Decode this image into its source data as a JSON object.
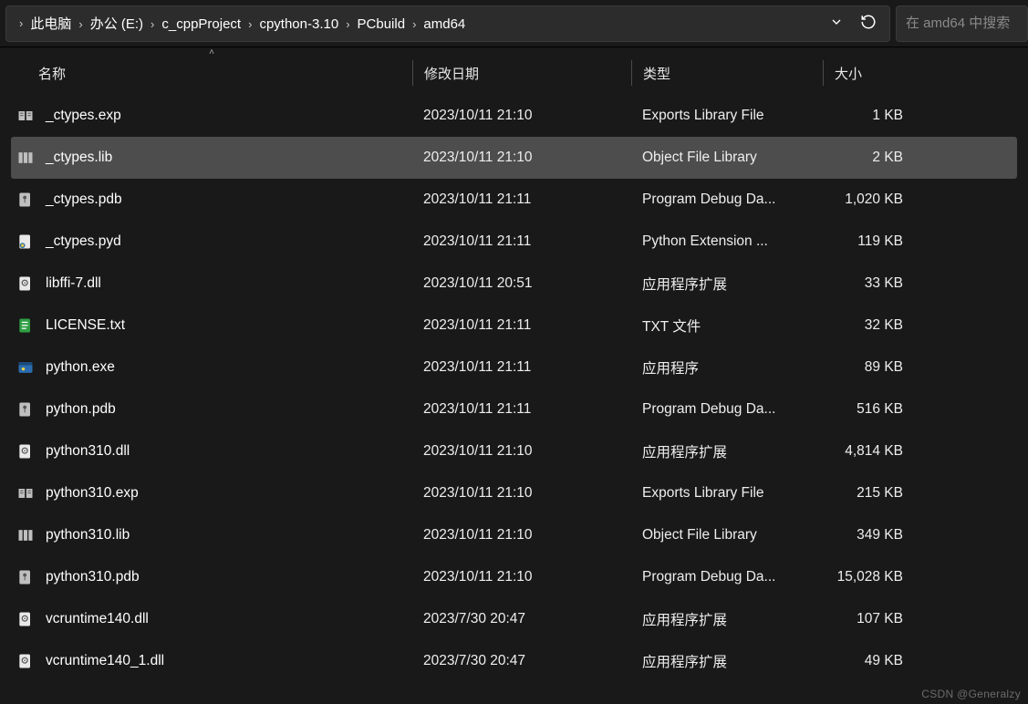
{
  "breadcrumb": {
    "items": [
      {
        "label": "此电脑"
      },
      {
        "label": "办公 (E:)"
      },
      {
        "label": "c_cppProject"
      },
      {
        "label": "cpython-3.10"
      },
      {
        "label": "PCbuild"
      },
      {
        "label": "amd64"
      }
    ]
  },
  "search": {
    "placeholder": "在 amd64 中搜索"
  },
  "columns": {
    "name": "名称",
    "date": "修改日期",
    "type": "类型",
    "size": "大小"
  },
  "files": [
    {
      "icon": "exp",
      "name": "_ctypes.exp",
      "date": "2023/10/11 21:10",
      "type": "Exports Library File",
      "size": "1 KB",
      "selected": false
    },
    {
      "icon": "lib",
      "name": "_ctypes.lib",
      "date": "2023/10/11 21:10",
      "type": "Object File Library",
      "size": "2 KB",
      "selected": true
    },
    {
      "icon": "pdb",
      "name": "_ctypes.pdb",
      "date": "2023/10/11 21:11",
      "type": "Program Debug Da...",
      "size": "1,020 KB",
      "selected": false
    },
    {
      "icon": "pyd",
      "name": "_ctypes.pyd",
      "date": "2023/10/11 21:11",
      "type": "Python Extension ...",
      "size": "119 KB",
      "selected": false
    },
    {
      "icon": "dll",
      "name": "libffi-7.dll",
      "date": "2023/10/11 20:51",
      "type": "应用程序扩展",
      "size": "33 KB",
      "selected": false
    },
    {
      "icon": "txt",
      "name": "LICENSE.txt",
      "date": "2023/10/11 21:11",
      "type": "TXT 文件",
      "size": "32 KB",
      "selected": false
    },
    {
      "icon": "exe",
      "name": "python.exe",
      "date": "2023/10/11 21:11",
      "type": "应用程序",
      "size": "89 KB",
      "selected": false
    },
    {
      "icon": "pdb",
      "name": "python.pdb",
      "date": "2023/10/11 21:11",
      "type": "Program Debug Da...",
      "size": "516 KB",
      "selected": false
    },
    {
      "icon": "dll",
      "name": "python310.dll",
      "date": "2023/10/11 21:10",
      "type": "应用程序扩展",
      "size": "4,814 KB",
      "selected": false
    },
    {
      "icon": "exp",
      "name": "python310.exp",
      "date": "2023/10/11 21:10",
      "type": "Exports Library File",
      "size": "215 KB",
      "selected": false
    },
    {
      "icon": "lib",
      "name": "python310.lib",
      "date": "2023/10/11 21:10",
      "type": "Object File Library",
      "size": "349 KB",
      "selected": false
    },
    {
      "icon": "pdb",
      "name": "python310.pdb",
      "date": "2023/10/11 21:10",
      "type": "Program Debug Da...",
      "size": "15,028 KB",
      "selected": false
    },
    {
      "icon": "dll",
      "name": "vcruntime140.dll",
      "date": "2023/7/30 20:47",
      "type": "应用程序扩展",
      "size": "107 KB",
      "selected": false
    },
    {
      "icon": "dll",
      "name": "vcruntime140_1.dll",
      "date": "2023/7/30 20:47",
      "type": "应用程序扩展",
      "size": "49 KB",
      "selected": false
    }
  ],
  "watermark": "CSDN @Generalzy"
}
